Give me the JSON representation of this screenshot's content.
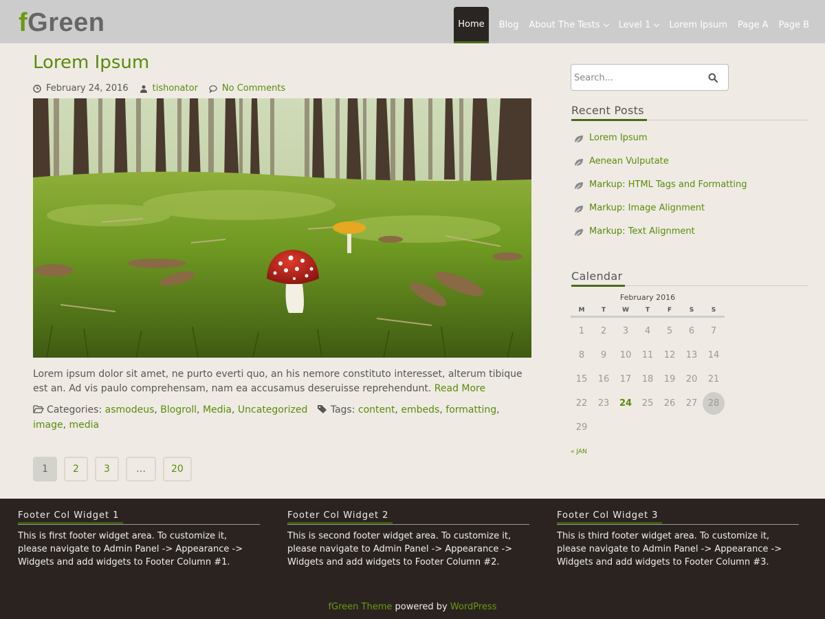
{
  "logo": {
    "first": "f",
    "rest": "Green"
  },
  "nav": [
    {
      "label": "Home",
      "active": true,
      "has_sub": false
    },
    {
      "label": "Blog",
      "has_sub": false
    },
    {
      "label": "About The Tests",
      "has_sub": true
    },
    {
      "label": "Level 1",
      "has_sub": true
    },
    {
      "label": "Lorem Ipsum",
      "has_sub": false
    },
    {
      "label": "Page A",
      "has_sub": false
    },
    {
      "label": "Page B",
      "has_sub": false
    }
  ],
  "post": {
    "title": "Lorem Ipsum",
    "date": "February 24, 2016",
    "author": "tishonator",
    "comments": "No Comments",
    "excerpt": "Lorem ipsum dolor sit amet, ne purto everti quo, an his nemore constituto interesset, alterum tibique est an. Ad vis paulo comprehensam, nam ea accusamus deseruisse reprehendunt.",
    "read_more": "Read More",
    "categories_label": "Categories:",
    "categories": [
      "asmodeus",
      "Blogroll",
      "Media",
      "Uncategorized"
    ],
    "tags_label": "Tags:",
    "tags": [
      "content",
      "embeds",
      "formatting",
      "image",
      "media"
    ]
  },
  "pagination": [
    "1",
    "2",
    "3",
    "…",
    "20"
  ],
  "search": {
    "placeholder": "Search..."
  },
  "recent_posts": {
    "title": "Recent Posts",
    "items": [
      "Lorem Ipsum",
      "Aenean Vulputate",
      "Markup: HTML Tags and Formatting",
      "Markup: Image Alignment",
      "Markup: Text Alignment"
    ]
  },
  "calendar": {
    "title": "Calendar",
    "caption": "February 2016",
    "weekdays": [
      "M",
      "T",
      "W",
      "T",
      "F",
      "S",
      "S"
    ],
    "days": [
      "1",
      "2",
      "3",
      "4",
      "5",
      "6",
      "7",
      "8",
      "9",
      "10",
      "11",
      "12",
      "13",
      "14",
      "15",
      "16",
      "17",
      "18",
      "19",
      "20",
      "21",
      "22",
      "23",
      "24",
      "25",
      "26",
      "27",
      "28",
      "29"
    ],
    "linked_day": "24",
    "today": "28",
    "prev_label": "« JAN"
  },
  "footer": {
    "columns": [
      {
        "title": "Footer Col Widget 1",
        "text": "This is first footer widget area. To customize it, please navigate to Admin Panel -> Appearance -> Widgets and add widgets to Footer Column #1."
      },
      {
        "title": "Footer Col Widget 2",
        "text": "This is second footer widget area. To customize it, please navigate to Admin Panel -> Appearance -> Widgets and add widgets to Footer Column #2."
      },
      {
        "title": "Footer Col Widget 3",
        "text": "This is third footer widget area. To customize it, please navigate to Admin Panel -> Appearance -> Widgets and add widgets to Footer Column #3."
      }
    ],
    "credit_theme": "fGreen Theme",
    "credit_middle": "powered by",
    "credit_wp": "WordPress"
  },
  "colors": {
    "accent": "#5a8a0a",
    "header_bg": "#cccccc",
    "body_bg": "#efebe4",
    "footer_bg": "#2a2320",
    "active_nav_bg": "#2a2522"
  }
}
